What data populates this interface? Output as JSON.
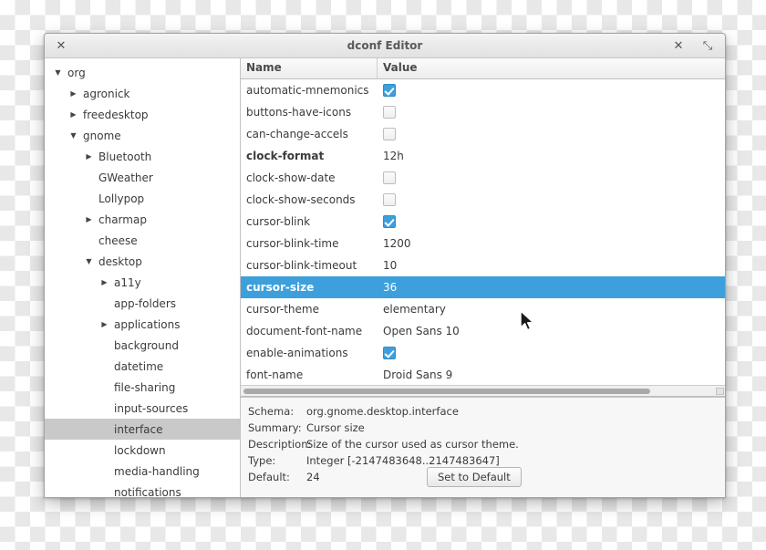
{
  "window": {
    "title": "dconf Editor",
    "left_button_icon": "close-icon",
    "left_button_glyph": "✕",
    "close_glyph": "✕",
    "maximize_glyph": "⤡",
    "accent_color": "#3d9fdc",
    "selected_tree_color": "#c9c9c9"
  },
  "sidebar": {
    "items": [
      {
        "label": "org",
        "depth": 0,
        "twisty": "down",
        "selected": false
      },
      {
        "label": "agronick",
        "depth": 1,
        "twisty": "right",
        "selected": false
      },
      {
        "label": "freedesktop",
        "depth": 1,
        "twisty": "right",
        "selected": false
      },
      {
        "label": "gnome",
        "depth": 1,
        "twisty": "down",
        "selected": false
      },
      {
        "label": "Bluetooth",
        "depth": 2,
        "twisty": "right",
        "selected": false
      },
      {
        "label": "GWeather",
        "depth": 2,
        "twisty": "none",
        "selected": false
      },
      {
        "label": "Lollypop",
        "depth": 2,
        "twisty": "none",
        "selected": false
      },
      {
        "label": "charmap",
        "depth": 2,
        "twisty": "right",
        "selected": false
      },
      {
        "label": "cheese",
        "depth": 2,
        "twisty": "none",
        "selected": false
      },
      {
        "label": "desktop",
        "depth": 2,
        "twisty": "down",
        "selected": false
      },
      {
        "label": "a11y",
        "depth": 3,
        "twisty": "right",
        "selected": false
      },
      {
        "label": "app-folders",
        "depth": 3,
        "twisty": "none",
        "selected": false
      },
      {
        "label": "applications",
        "depth": 3,
        "twisty": "right",
        "selected": false
      },
      {
        "label": "background",
        "depth": 3,
        "twisty": "none",
        "selected": false
      },
      {
        "label": "datetime",
        "depth": 3,
        "twisty": "none",
        "selected": false
      },
      {
        "label": "file-sharing",
        "depth": 3,
        "twisty": "none",
        "selected": false
      },
      {
        "label": "input-sources",
        "depth": 3,
        "twisty": "none",
        "selected": false
      },
      {
        "label": "interface",
        "depth": 3,
        "twisty": "none",
        "selected": true
      },
      {
        "label": "lockdown",
        "depth": 3,
        "twisty": "none",
        "selected": false
      },
      {
        "label": "media-handling",
        "depth": 3,
        "twisty": "none",
        "selected": false
      },
      {
        "label": "notifications",
        "depth": 3,
        "twisty": "none",
        "selected": false
      }
    ]
  },
  "list": {
    "columns": {
      "name": "Name",
      "value": "Value"
    },
    "rows": [
      {
        "name": "automatic-mnemonics",
        "value": "",
        "type": "checkbox",
        "checked": true,
        "bold": false,
        "selected": false
      },
      {
        "name": "buttons-have-icons",
        "value": "",
        "type": "checkbox",
        "checked": false,
        "bold": false,
        "selected": false
      },
      {
        "name": "can-change-accels",
        "value": "",
        "type": "checkbox",
        "checked": false,
        "bold": false,
        "selected": false
      },
      {
        "name": "clock-format",
        "value": "12h",
        "type": "text",
        "checked": null,
        "bold": true,
        "selected": false
      },
      {
        "name": "clock-show-date",
        "value": "",
        "type": "checkbox",
        "checked": false,
        "bold": false,
        "selected": false
      },
      {
        "name": "clock-show-seconds",
        "value": "",
        "type": "checkbox",
        "checked": false,
        "bold": false,
        "selected": false
      },
      {
        "name": "cursor-blink",
        "value": "",
        "type": "checkbox",
        "checked": true,
        "bold": false,
        "selected": false
      },
      {
        "name": "cursor-blink-time",
        "value": "1200",
        "type": "text",
        "checked": null,
        "bold": false,
        "selected": false
      },
      {
        "name": "cursor-blink-timeout",
        "value": "10",
        "type": "text",
        "checked": null,
        "bold": false,
        "selected": false
      },
      {
        "name": "cursor-size",
        "value": "36",
        "type": "text",
        "checked": null,
        "bold": true,
        "selected": true
      },
      {
        "name": "cursor-theme",
        "value": "elementary",
        "type": "text",
        "checked": null,
        "bold": false,
        "selected": false
      },
      {
        "name": "document-font-name",
        "value": "Open Sans 10",
        "type": "text",
        "checked": null,
        "bold": false,
        "selected": false
      },
      {
        "name": "enable-animations",
        "value": "",
        "type": "checkbox",
        "checked": true,
        "bold": false,
        "selected": false
      },
      {
        "name": "font-name",
        "value": "Droid Sans 9",
        "type": "text",
        "checked": null,
        "bold": false,
        "selected": false
      }
    ]
  },
  "detail": {
    "schema_label": "Schema:",
    "schema_value": "org.gnome.desktop.interface",
    "summary_label": "Summary:",
    "summary_value": "Cursor size",
    "description_label": "Description:",
    "description_value": "Size of the cursor used as cursor theme.",
    "type_label": "Type:",
    "type_value": "Integer [-2147483648..2147483647]",
    "default_label": "Default:",
    "default_value": "24",
    "set_default_button": "Set to Default"
  }
}
